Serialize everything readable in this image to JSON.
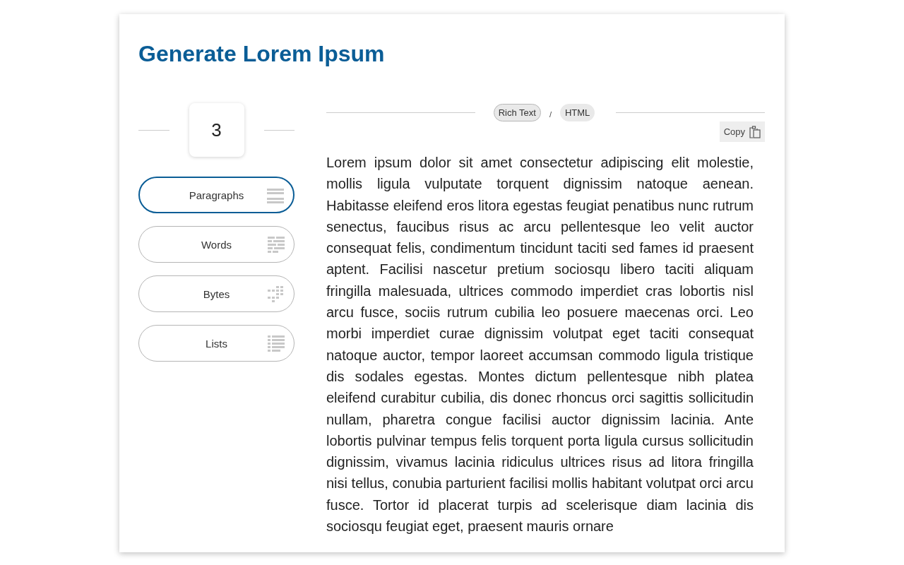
{
  "title": "Generate Lorem Ipsum",
  "count": "3",
  "units": [
    {
      "label": "Paragraphs",
      "kind": "paragraphs",
      "selected": true
    },
    {
      "label": "Words",
      "kind": "words",
      "selected": false
    },
    {
      "label": "Bytes",
      "kind": "bytes",
      "selected": false
    },
    {
      "label": "Lists",
      "kind": "lists",
      "selected": false
    }
  ],
  "formats": [
    {
      "label": "Rich Text",
      "selected": true
    },
    {
      "label": "HTML",
      "selected": false
    }
  ],
  "separator": "/",
  "copy_button": "Copy",
  "output": "Lorem ipsum dolor sit amet consectetur adipiscing elit molestie, mollis ligula vulputate torquent dignissim natoque aenean. Habitasse eleifend eros litora egestas feugiat penatibus nunc rutrum senectus, faucibus risus ac arcu pellentesque leo velit auctor consequat felis, condimentum tincidunt taciti sed fames id praesent aptent. Facilisi nascetur pretium sociosqu libero taciti aliquam fringilla malesuada, ultrices commodo imperdiet cras lobortis nisl arcu fusce, sociis rutrum cubilia leo posuere maecenas orci. Leo morbi imperdiet curae dignissim volutpat eget taciti consequat natoque auctor, tempor laoreet accumsan commodo ligula tristique dis sodales egestas. Montes dictum pellentesque nibh platea eleifend curabitur cubilia, dis donec rhoncus orci sagittis sollicitudin nullam, pharetra congue facilisi auctor dignissim lacinia. Ante lobortis pulvinar tempus felis torquent porta ligula cursus sollicitudin dignissim, vivamus lacinia ridiculus ultrices risus ad litora fringilla nisi tellus, conubia parturient facilisi mollis habitant volutpat orci arcu fusce. Tortor id placerat turpis ad scelerisque diam lacinia dis sociosqu feugiat eget, praesent mauris ornare"
}
